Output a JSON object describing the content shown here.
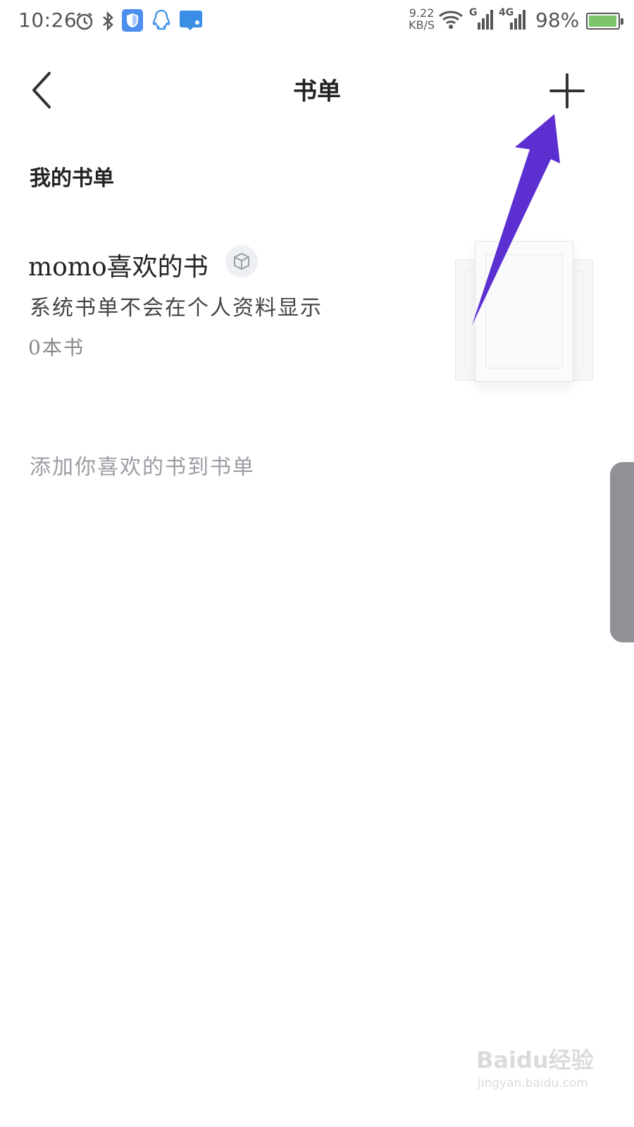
{
  "status_bar": {
    "time": "10:26",
    "net_speed_value": "9.22",
    "net_speed_unit": "KB/S",
    "network_type_1": "G",
    "network_type_2": "4G",
    "battery_percent": "98%",
    "battery_level": 0.98,
    "icons": [
      "alarm-icon",
      "bluetooth-icon",
      "shield-icon",
      "qq-icon",
      "message-icon",
      "wifi-icon",
      "signal-icon",
      "signal-4g-icon",
      "battery-icon"
    ]
  },
  "nav": {
    "title": "书单",
    "back_icon": "chevron-left-icon",
    "add_icon": "plus-icon"
  },
  "section": {
    "title": "我的书单"
  },
  "booklist": {
    "title": "momo喜欢的书",
    "badge_icon": "cube-icon",
    "description": "系统书单不会在个人资料显示",
    "count": "0本书"
  },
  "hint": "添加你喜欢的书到书单",
  "watermark": {
    "logo_text": "Baidu经验",
    "url": "jingyan.baidu.com"
  },
  "colors": {
    "arrow": "#5b2fd0",
    "text_primary": "#222222",
    "text_secondary": "#888888",
    "battery_fill": "#7cc56b"
  }
}
